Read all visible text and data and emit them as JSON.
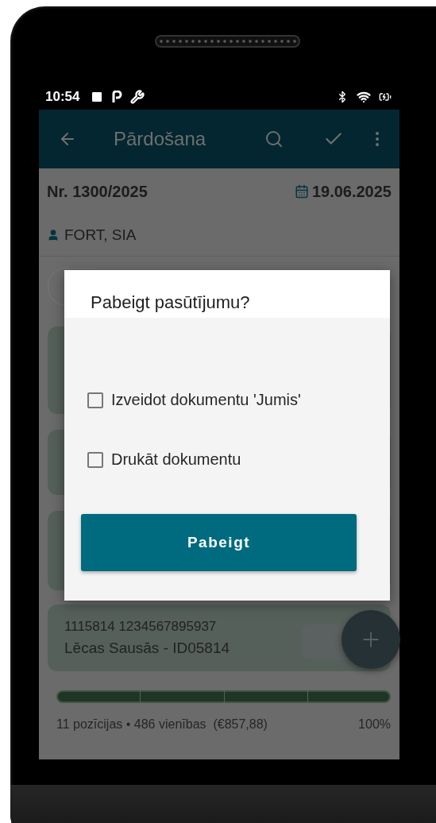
{
  "status_bar": {
    "time": "10:54"
  },
  "app_bar": {
    "title": "Pārdošana"
  },
  "order": {
    "number": "Nr. 1300/2025",
    "date": "19.06.2025",
    "customer": "FORT, SIA"
  },
  "items": [
    {
      "code": "1115814 1234567895937",
      "name": "Lēcas Sausās - ID05814"
    }
  ],
  "summary": {
    "text": "11 pozīcijas • 486 vienības  (€857,88)",
    "percent": "100%",
    "level": 1
  },
  "dialog": {
    "title": "Pabeigt pasūtījumu?",
    "options": [
      {
        "label": "Izveidot dokumentu 'Jumis'",
        "checked": false
      },
      {
        "label": "Drukāt dokumentu",
        "checked": false
      }
    ],
    "button": "Pabeigt"
  }
}
